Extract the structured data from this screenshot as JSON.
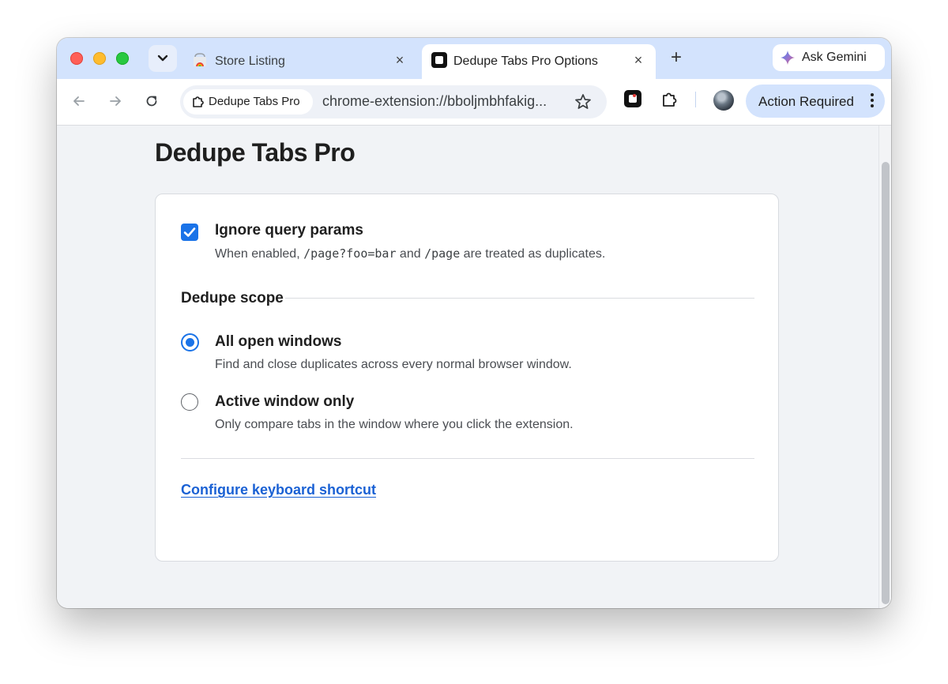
{
  "browser": {
    "tabs": [
      {
        "title": "Store Listing",
        "active": false,
        "close": "×"
      },
      {
        "title": "Dedupe Tabs Pro Options",
        "active": true,
        "close": "×"
      }
    ],
    "new_tab": "+",
    "gemini_label": "Ask Gemini",
    "omnibox": {
      "chip_label": "Dedupe Tabs Pro",
      "url": "chrome-extension://bboljmbhfakig..."
    },
    "action_button_label": "Action Required"
  },
  "page": {
    "title": "Dedupe Tabs Pro",
    "ignore_query": {
      "checked": true,
      "title": "Ignore query params",
      "desc_prefix": "When enabled, ",
      "code1": "/page?foo=bar",
      "desc_middle": " and ",
      "code2": "/page",
      "desc_suffix": " are treated as duplicates."
    },
    "scope": {
      "label": "Dedupe scope",
      "options": [
        {
          "title": "All open windows",
          "desc": "Find and close duplicates across every normal browser window.",
          "selected": true
        },
        {
          "title": "Active window only",
          "desc": "Only compare tabs in the window where you click the extension.",
          "selected": false
        }
      ]
    },
    "shortcut_link": "Configure keyboard shortcut"
  },
  "colors": {
    "accent": "#1a73e8",
    "link": "#1a61d4",
    "tabstrip": "#d3e3fd",
    "page_bg": "#f1f3f6"
  }
}
